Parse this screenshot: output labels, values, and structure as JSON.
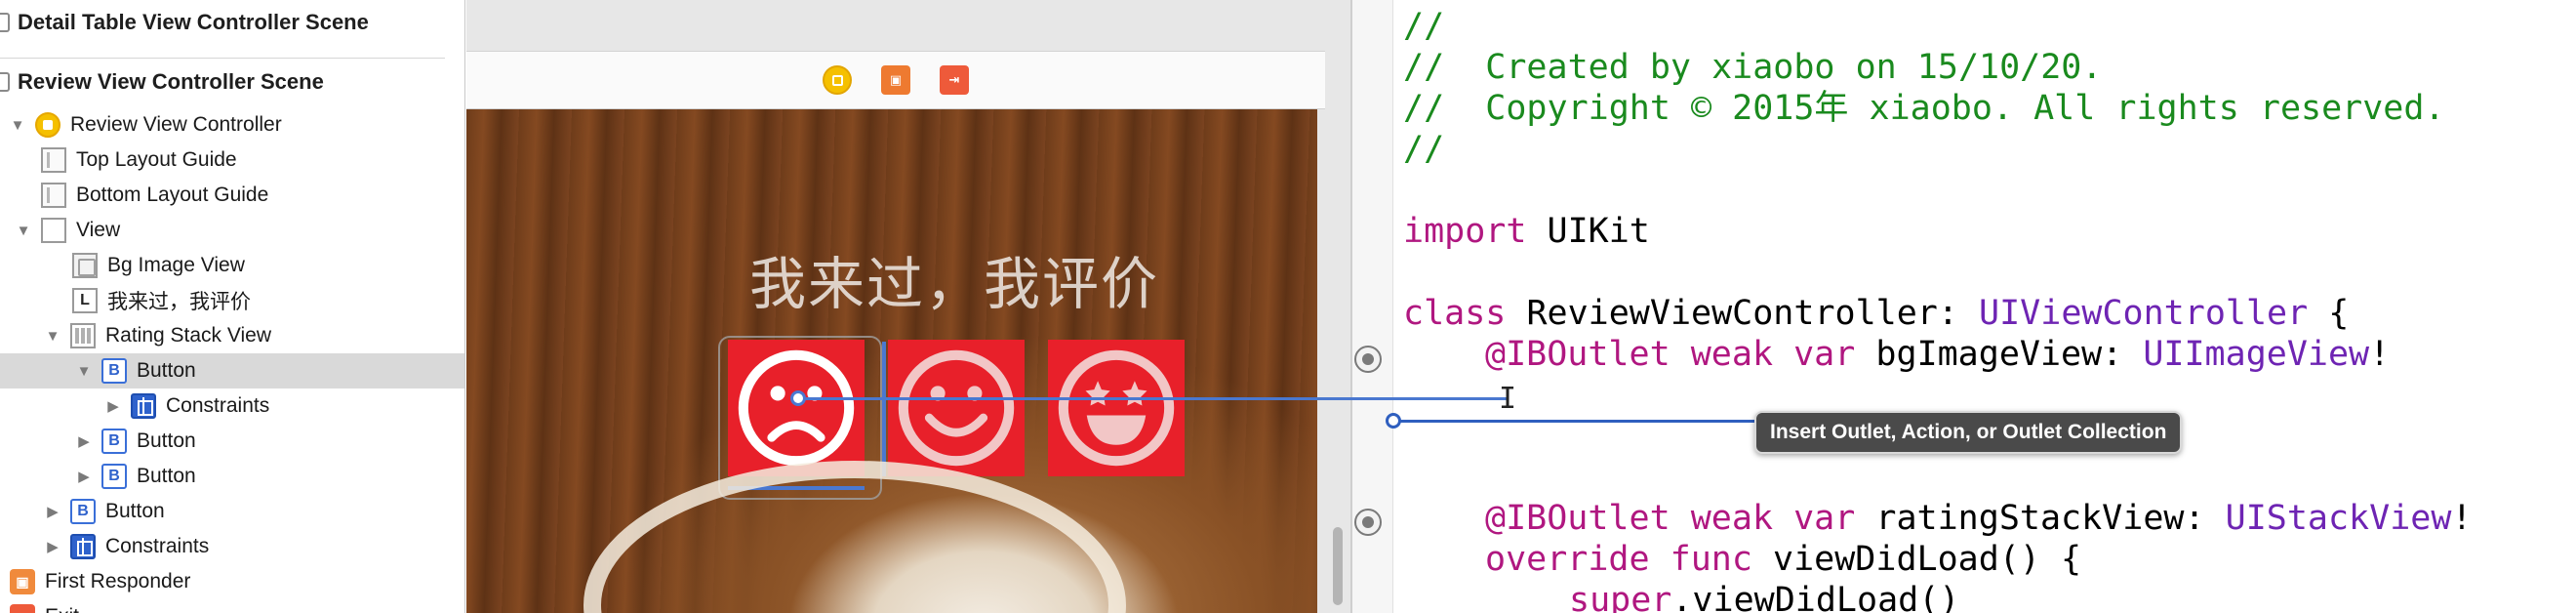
{
  "outline": {
    "scene_detail_header": "Detail Table View Controller Scene",
    "scene_review_header": "Review View Controller Scene",
    "items": [
      {
        "label": "Review View Controller",
        "icon": "view-controller-icon"
      },
      {
        "label": "Top Layout Guide",
        "icon": "layout-guide-icon"
      },
      {
        "label": "Bottom Layout Guide",
        "icon": "layout-guide-icon"
      },
      {
        "label": "View",
        "icon": "view-icon"
      },
      {
        "label": "Bg Image View",
        "icon": "image-view-icon"
      },
      {
        "label": "我来过，我评价",
        "icon": "label-icon"
      },
      {
        "label": "Rating Stack View",
        "icon": "stack-view-icon"
      },
      {
        "label": "Button",
        "icon": "button-icon"
      },
      {
        "label": "Constraints",
        "icon": "constraints-icon"
      },
      {
        "label": "Button",
        "icon": "button-icon"
      },
      {
        "label": "Button",
        "icon": "button-icon"
      },
      {
        "label": "Button",
        "icon": "button-icon"
      },
      {
        "label": "Constraints",
        "icon": "constraints-icon"
      },
      {
        "label": "First Responder",
        "icon": "first-responder-icon"
      },
      {
        "label": "Exit",
        "icon": "exit-icon"
      }
    ],
    "icon_glyphs": {
      "label": "L",
      "button": "B"
    }
  },
  "canvas": {
    "scene_title": "我来过，我评价",
    "rating_buttons": [
      "sad-face-icon",
      "smile-face-icon",
      "star-eyes-face-icon"
    ],
    "button_color": "#e8202a"
  },
  "editor": {
    "lines": [
      {
        "kind": "comment",
        "text": "//"
      },
      {
        "kind": "comment",
        "text": "//  Created by xiaobo on 15/10/20."
      },
      {
        "kind": "comment",
        "text": "//  Copyright © 2015年 xiaobo. All rights reserved."
      },
      {
        "kind": "comment",
        "text": "//"
      }
    ],
    "import_kw": "import",
    "import_mod": "UIKit",
    "class_kw": "class",
    "class_name": "ReviewViewController:",
    "superclass": "UIViewController",
    "brace_open": "{",
    "outlet1_attr": "@IBOutlet",
    "outlet1_mods": "weak var",
    "outlet1_name": "bgImageView:",
    "outlet1_type": "UIImageView",
    "outlet1_bang": "!",
    "outlet2_attr": "@IBOutlet",
    "outlet2_mods": "weak var",
    "outlet2_name": "ratingStackView:",
    "outlet2_type": "UIStackView",
    "outlet2_bang": "!",
    "override_kw": "override func",
    "override_sig": "viewDidLoad() {",
    "super_kw": "super",
    "super_call": ".viewDidLoad()",
    "colors": {
      "comment": "#1a8a1e",
      "keyword": "#b01780",
      "type": "#6e24b3"
    }
  },
  "tooltip": {
    "text": "Insert Outlet, Action, or Outlet Collection"
  }
}
